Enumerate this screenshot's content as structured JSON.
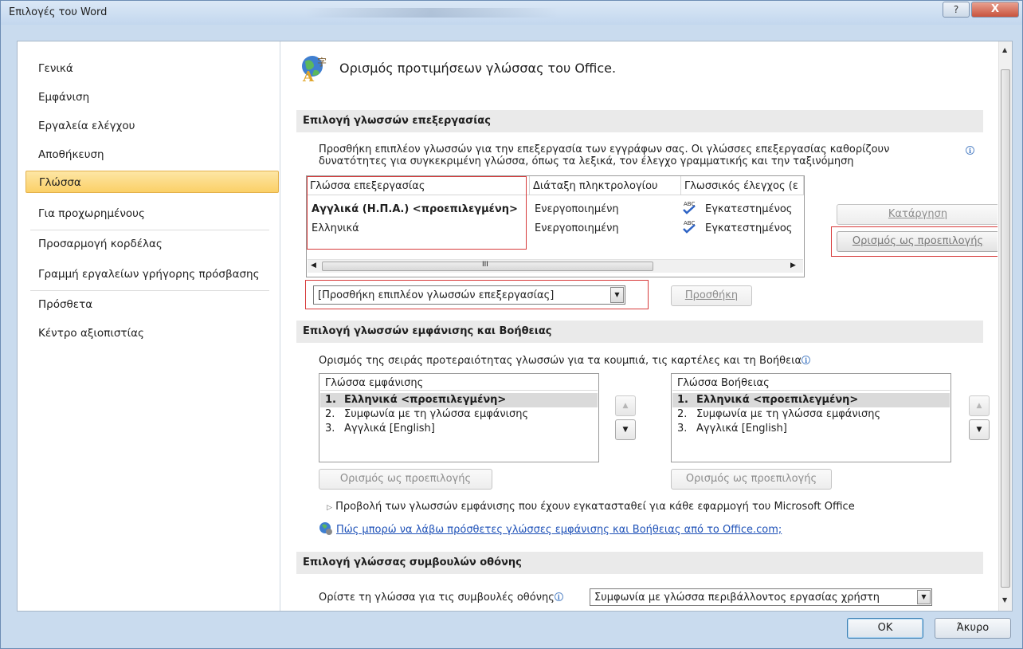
{
  "window": {
    "title": "Επιλογές του Word",
    "help_label": "?",
    "close_label": "X"
  },
  "nav": {
    "items": [
      {
        "label": "Γενικά"
      },
      {
        "label": "Εμφάνιση"
      },
      {
        "label": "Εργαλεία ελέγχου"
      },
      {
        "label": "Αποθήκευση"
      },
      {
        "label": "Γλώσσα",
        "selected": true
      },
      {
        "label": "Για προχωρημένους"
      },
      {
        "label": "Προσαρμογή κορδέλας"
      },
      {
        "label": "Γραμμή εργαλείων γρήγορης πρόσβασης"
      },
      {
        "label": "Πρόσθετα"
      },
      {
        "label": "Κέντρο αξιοπιστίας"
      }
    ]
  },
  "content": {
    "heading": "Ορισμός προτιμήσεων γλώσσας του Office.",
    "editing": {
      "section_title": "Επιλογή γλωσσών επεξεργασίας",
      "description_line1": "Προσθήκη επιπλέον γλωσσών για την επεξεργασία των εγγράφων σας. Οι γλώσσες επεξεργασίας καθορίζουν",
      "description_line2": "δυνατότητες για συγκεκριμένη γλώσσα, όπως τα λεξικά, τον έλεγχο γραμματικής και την ταξινόμηση",
      "columns": [
        "Γλώσσα επεξεργασίας",
        "Διάταξη πληκτρολογίου",
        "Γλωσσικός έλεγχος (ε"
      ],
      "rows": [
        {
          "language": "Αγγλικά (Η.Π.Α.) <προεπιλεγμένη>",
          "keyboard": "Ενεργοποιημένη",
          "proofing": "Εγκατεστημένος"
        },
        {
          "language": "Ελληνικά",
          "keyboard": "Ενεργοποιημένη",
          "proofing": "Εγκατεστημένος"
        }
      ],
      "hscroll_grip": "III",
      "remove_button": "Κατάργηση",
      "set_default_button": "Ορισμός ως προεπιλογής",
      "add_dropdown_value": "[Προσθήκη επιπλέον γλωσσών επεξεργασίας]",
      "add_button": "Προσθήκη"
    },
    "display": {
      "section_title": "Επιλογή γλωσσών εμφάνισης και Βοήθειας",
      "description": "Ορισμός της σειράς προτεραιότητας γλωσσών για τα κουμπιά, τις καρτέλες και τη Βοήθεια",
      "display_list": {
        "header": "Γλώσσα εμφάνισης",
        "items": [
          {
            "num": "1.",
            "label": "Ελληνικά <προεπιλεγμένη>"
          },
          {
            "num": "2.",
            "label": "Συμφωνία με τη γλώσσα εμφάνισης"
          },
          {
            "num": "3.",
            "label": "Αγγλικά [English]"
          }
        ]
      },
      "help_list": {
        "header": "Γλώσσα Βοήθειας",
        "items": [
          {
            "num": "1.",
            "label": "Ελληνικά <προεπιλεγμένη>"
          },
          {
            "num": "2.",
            "label": "Συμφωνία με τη γλώσσα εμφάνισης"
          },
          {
            "num": "3.",
            "label": "Αγγλικά [English]"
          }
        ]
      },
      "set_default_button": "Ορισμός ως προεπιλογής",
      "view_installed": "Προβολή των γλωσσών εμφάνισης που έχουν εγκατασταθεί για κάθε εφαρμογή του Microsoft Office",
      "more_languages_link": "Πώς μπορώ να λάβω πρόσθετες γλώσσες εμφάνισης και Βοήθειας από το Office.com;"
    },
    "screentip": {
      "section_title": "Επιλογή γλώσσας συμβουλών οθόνης",
      "label": "Ορίστε τη γλώσσα για τις συμβουλές οθόνης",
      "dropdown_value": "Συμφωνία με γλώσσα περιβάλλοντος εργασίας χρήστη"
    }
  },
  "footer": {
    "ok_label": "OK",
    "cancel_label": "Άκυρο"
  },
  "colors": {
    "selected_nav": "#fbd067",
    "highlight_box": "#d73b3b",
    "link": "#1f52b8"
  }
}
